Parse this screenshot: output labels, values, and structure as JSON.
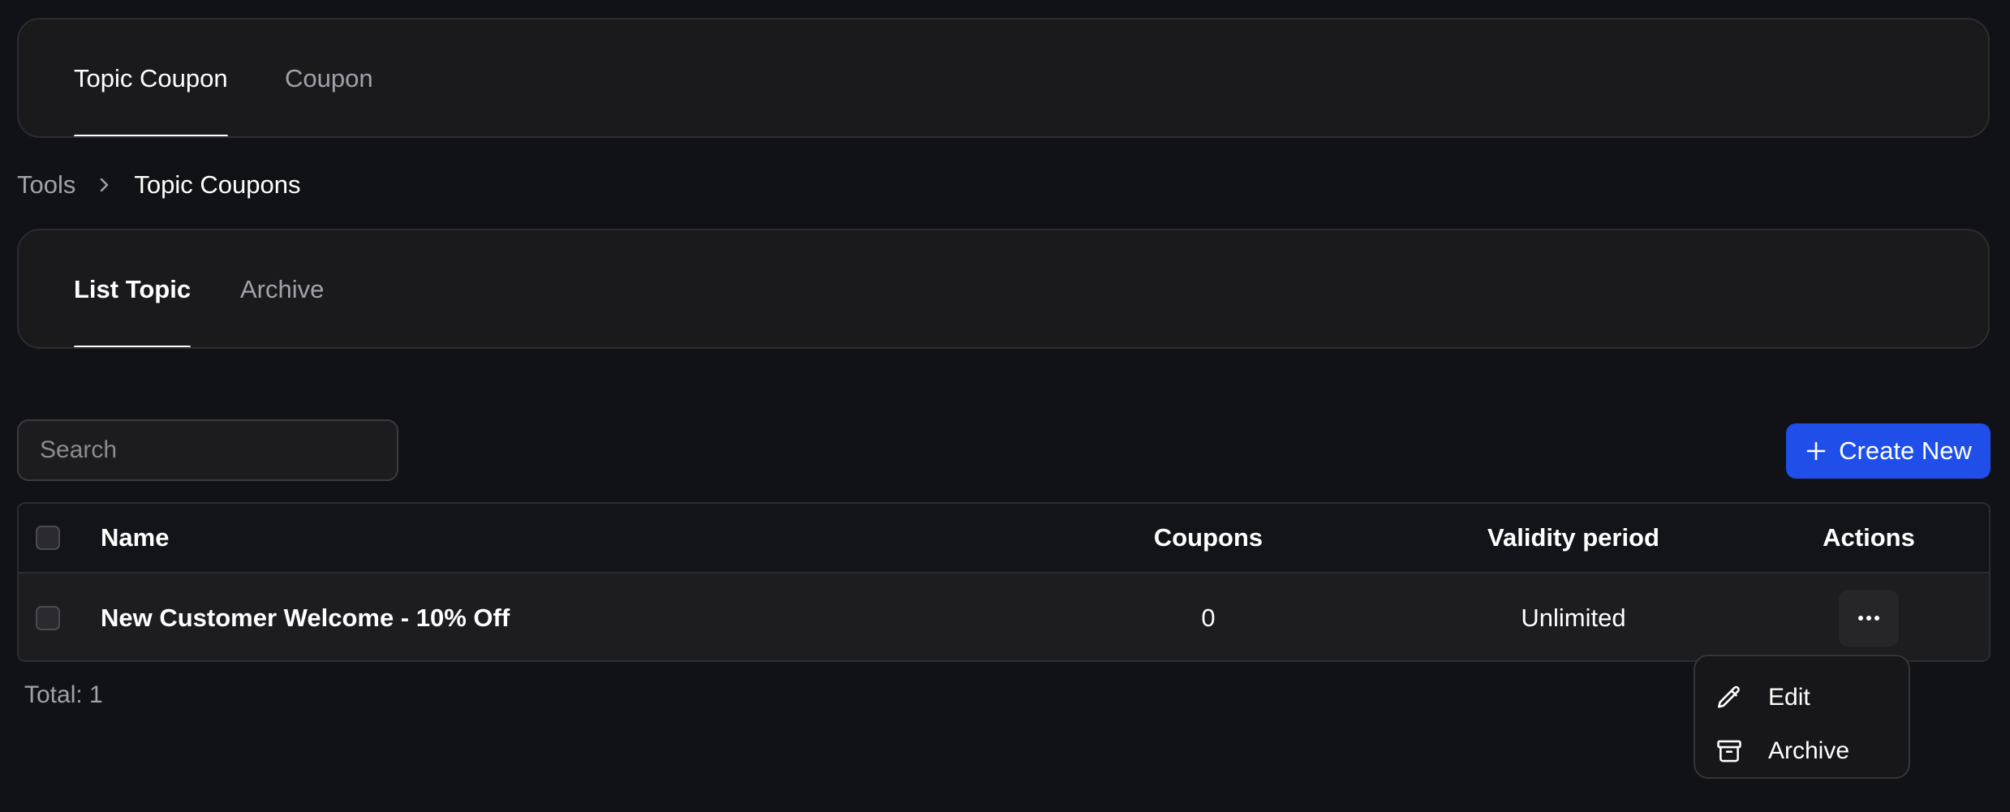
{
  "top_tabs": [
    {
      "label": "Topic Coupon",
      "active": true
    },
    {
      "label": "Coupon",
      "active": false
    }
  ],
  "breadcrumb": {
    "parent": "Tools",
    "current": "Topic Coupons"
  },
  "sub_tabs": [
    {
      "label": "List Topic",
      "active": true
    },
    {
      "label": "Archive",
      "active": false
    }
  ],
  "search": {
    "placeholder": "Search",
    "value": ""
  },
  "create_button": {
    "label": "Create New",
    "icon": "plus-icon"
  },
  "table": {
    "headers": {
      "name": "Name",
      "coupons": "Coupons",
      "validity": "Validity period",
      "actions": "Actions"
    },
    "rows": [
      {
        "name": "New Customer Welcome - 10% Off",
        "coupons": "0",
        "validity": "Unlimited"
      }
    ]
  },
  "total": "Total: 1",
  "actions_menu": {
    "items": [
      {
        "label": "Edit",
        "icon": "pencil-icon"
      },
      {
        "label": "Archive",
        "icon": "archive-box-icon"
      }
    ]
  },
  "colors": {
    "background": "#111217",
    "card": "#1a1a1d",
    "accent": "#1f4fe8",
    "muted_text": "#a1a1aa"
  }
}
